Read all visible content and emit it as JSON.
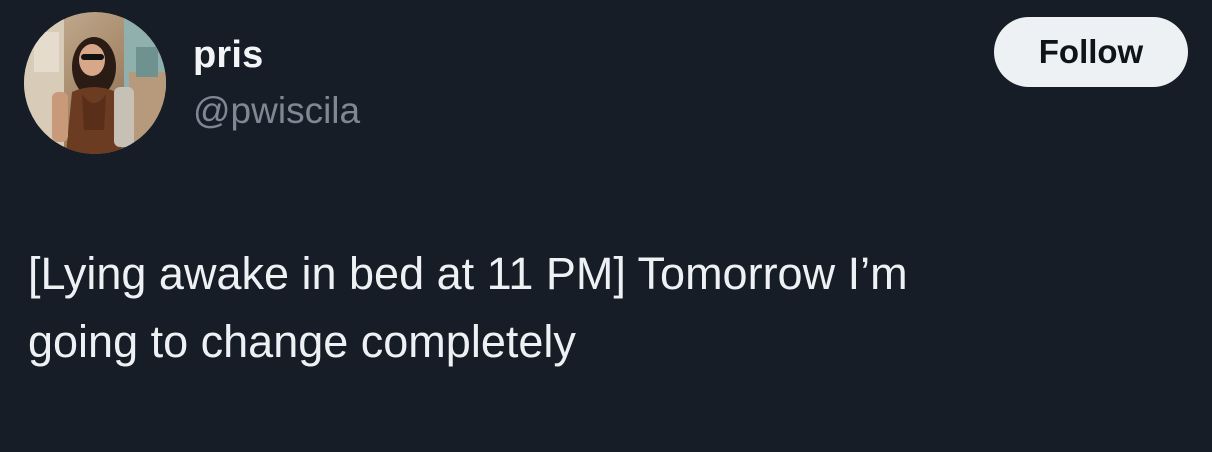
{
  "author": {
    "display_name": "pris",
    "handle": "@pwiscila",
    "avatar_icon": "profile-photo"
  },
  "follow_button": {
    "label": "Follow"
  },
  "tweet": {
    "text_lines": [
      "[Lying awake in bed at 11 PM] Tomorrow I’m",
      "going to change completely"
    ]
  },
  "colors": {
    "background": "#161d27",
    "text_primary": "#eef1f4",
    "text_secondary": "#7d8894",
    "button_bg": "#eef1f3",
    "button_text": "#0f1419"
  }
}
